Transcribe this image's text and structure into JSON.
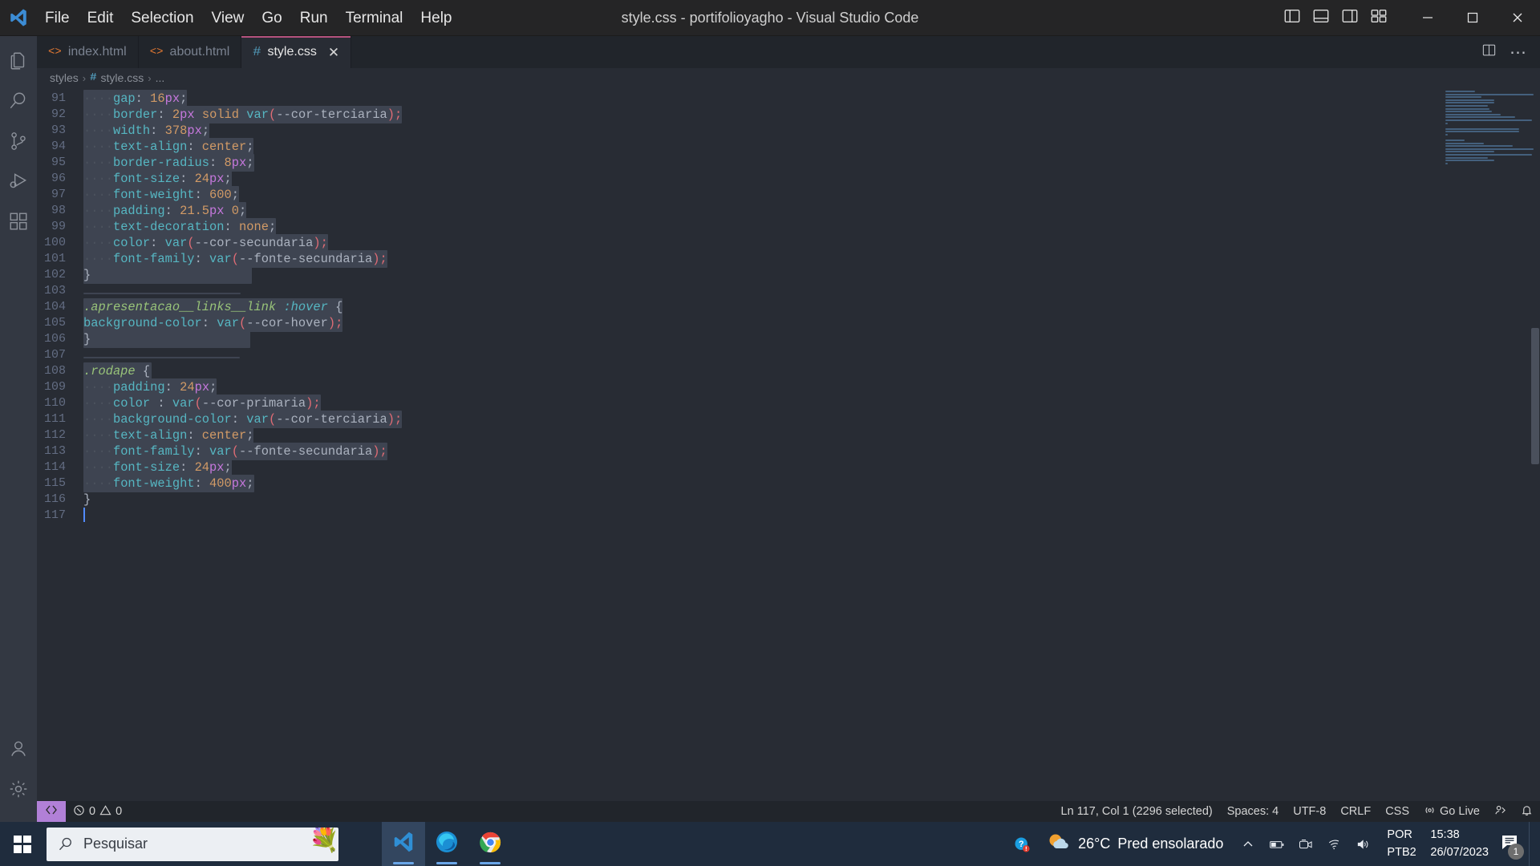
{
  "window": {
    "title": "style.css - portifolioyagho - Visual Studio Code",
    "app_logo": "vscode-logo"
  },
  "menubar": {
    "items": [
      {
        "label": "File"
      },
      {
        "label": "Edit"
      },
      {
        "label": "Selection"
      },
      {
        "label": "View"
      },
      {
        "label": "Go"
      },
      {
        "label": "Run"
      },
      {
        "label": "Terminal"
      },
      {
        "label": "Help"
      }
    ]
  },
  "titlebar_actions": {
    "icons": [
      "toggle-primary-sidebar-icon",
      "toggle-panel-icon",
      "toggle-secondary-sidebar-icon",
      "customize-layout-icon"
    ],
    "minimize": "minimize-icon",
    "maximize": "maximize-icon",
    "close": "close-icon"
  },
  "activitybar": {
    "top": [
      {
        "name": "explorer",
        "icon": "files-icon"
      },
      {
        "name": "search",
        "icon": "search-icon"
      },
      {
        "name": "source-control",
        "icon": "source-control-icon"
      },
      {
        "name": "run-and-debug",
        "icon": "debug-icon"
      },
      {
        "name": "extensions",
        "icon": "extensions-icon"
      }
    ],
    "bottom": [
      {
        "name": "accounts",
        "icon": "account-icon"
      },
      {
        "name": "settings",
        "icon": "gear-icon"
      }
    ]
  },
  "tabs": [
    {
      "label": "index.html",
      "icon": "html-file-icon",
      "icon_glyph": "<>",
      "active": false,
      "closable": false
    },
    {
      "label": "about.html",
      "icon": "html-file-icon",
      "icon_glyph": "<>",
      "active": false,
      "closable": false
    },
    {
      "label": "style.css",
      "icon": "css-file-icon",
      "icon_glyph": "#",
      "active": true,
      "closable": true,
      "close_glyph": "✕"
    }
  ],
  "tabsbar_actions": {
    "split_editor": "split-editor-icon",
    "more_actions": "⋯"
  },
  "breadcrumb": {
    "parts": [
      "styles",
      "style.css",
      "..."
    ],
    "separator": "›",
    "file_icon_glyph": "#"
  },
  "editor": {
    "language": "CSS",
    "first_line": 91,
    "lines": [
      {
        "no": 91,
        "indent": "    ",
        "tokens": [
          {
            "t": "gap",
            "c": "prop"
          },
          {
            "t": ": ",
            "c": "punc"
          },
          {
            "t": "16",
            "c": "num"
          },
          {
            "t": "px",
            "c": "unit"
          },
          {
            "t": ";",
            "c": "punc"
          }
        ],
        "sel_width": 92
      },
      {
        "no": 92,
        "indent": "    ",
        "tokens": [
          {
            "t": "border",
            "c": "prop"
          },
          {
            "t": ": ",
            "c": "punc"
          },
          {
            "t": "2",
            "c": "num"
          },
          {
            "t": "px",
            "c": "unit"
          },
          {
            "t": " ",
            "c": "punc"
          },
          {
            "t": "solid",
            "c": "kwsolid"
          },
          {
            "t": " ",
            "c": "punc"
          },
          {
            "t": "var",
            "c": "fn"
          },
          {
            "t": "(",
            "c": "paren"
          },
          {
            "t": "--cor-terciaria",
            "c": "varname"
          },
          {
            "t": ")",
            "c": "paren"
          },
          {
            "t": ";",
            "c": "paren"
          }
        ],
        "sel_width": 288
      },
      {
        "no": 93,
        "indent": "    ",
        "tokens": [
          {
            "t": "width",
            "c": "prop"
          },
          {
            "t": ": ",
            "c": "punc"
          },
          {
            "t": "378",
            "c": "num"
          },
          {
            "t": "px",
            "c": "unit"
          },
          {
            "t": ";",
            "c": "punc"
          }
        ],
        "sel_width": 115
      },
      {
        "no": 94,
        "indent": "    ",
        "tokens": [
          {
            "t": "text-align",
            "c": "prop"
          },
          {
            "t": ": ",
            "c": "punc"
          },
          {
            "t": "center",
            "c": "val"
          },
          {
            "t": ";",
            "c": "punc"
          }
        ],
        "sel_width": 152
      },
      {
        "no": 95,
        "indent": "    ",
        "tokens": [
          {
            "t": "border-radius",
            "c": "prop"
          },
          {
            "t": ": ",
            "c": "punc"
          },
          {
            "t": "8",
            "c": "num"
          },
          {
            "t": "px",
            "c": "unit"
          },
          {
            "t": ";",
            "c": "punc"
          }
        ],
        "sel_width": 155
      },
      {
        "no": 96,
        "indent": "    ",
        "tokens": [
          {
            "t": "font-size",
            "c": "prop"
          },
          {
            "t": ": ",
            "c": "punc"
          },
          {
            "t": "24",
            "c": "num"
          },
          {
            "t": "px",
            "c": "unit"
          },
          {
            "t": ";",
            "c": "punc"
          }
        ],
        "sel_width": 135
      },
      {
        "no": 97,
        "indent": "    ",
        "tokens": [
          {
            "t": "font-weight",
            "c": "prop"
          },
          {
            "t": ": ",
            "c": "punc"
          },
          {
            "t": "600",
            "c": "num"
          },
          {
            "t": ";",
            "c": "punc"
          }
        ],
        "sel_width": 140
      },
      {
        "no": 98,
        "indent": "    ",
        "tokens": [
          {
            "t": "padding",
            "c": "prop"
          },
          {
            "t": ": ",
            "c": "punc"
          },
          {
            "t": "21.5",
            "c": "num"
          },
          {
            "t": "px",
            "c": "unit"
          },
          {
            "t": " ",
            "c": "punc"
          },
          {
            "t": "0",
            "c": "num"
          },
          {
            "t": ";",
            "c": "punc"
          }
        ],
        "sel_width": 148
      },
      {
        "no": 99,
        "indent": "    ",
        "tokens": [
          {
            "t": "text-decoration",
            "c": "prop"
          },
          {
            "t": ": ",
            "c": "punc"
          },
          {
            "t": "none",
            "c": "val"
          },
          {
            "t": ";",
            "c": "punc"
          }
        ],
        "sel_width": 175
      },
      {
        "no": 100,
        "indent": "    ",
        "tokens": [
          {
            "t": "color",
            "c": "prop"
          },
          {
            "t": ": ",
            "c": "punc"
          },
          {
            "t": "var",
            "c": "fn"
          },
          {
            "t": "(",
            "c": "paren"
          },
          {
            "t": "--cor-secundaria",
            "c": "varname"
          },
          {
            "t": ")",
            "c": "paren"
          },
          {
            "t": ";",
            "c": "paren"
          }
        ],
        "sel_width": 220
      },
      {
        "no": 101,
        "indent": "    ",
        "tokens": [
          {
            "t": "font-family",
            "c": "prop"
          },
          {
            "t": ": ",
            "c": "punc"
          },
          {
            "t": "var",
            "c": "fn"
          },
          {
            "t": "(",
            "c": "paren"
          },
          {
            "t": "--fonte-secundaria",
            "c": "varname"
          },
          {
            "t": ")",
            "c": "paren"
          },
          {
            "t": ";",
            "c": "paren"
          }
        ],
        "sel_width": 272
      },
      {
        "no": 102,
        "indent": "",
        "tokens": [
          {
            "t": "}",
            "c": "brace"
          }
        ],
        "sel_width": 210
      },
      {
        "no": 103,
        "indent": "",
        "tokens": [],
        "sel_width": 196
      },
      {
        "no": 104,
        "indent": "",
        "tokens": [
          {
            "t": ".apresentacao__links__link",
            "c": "selector"
          },
          {
            "t": " ",
            "c": "punc"
          },
          {
            "t": ":hover",
            "c": "pseudo"
          },
          {
            "t": " ",
            "c": "punc"
          },
          {
            "t": "{",
            "c": "brace"
          }
        ],
        "sel_width": 235
      },
      {
        "no": 105,
        "indent": "",
        "tokens": [
          {
            "t": "background-color",
            "c": "prop"
          },
          {
            "t": ": ",
            "c": "punc"
          },
          {
            "t": "var",
            "c": "fn"
          },
          {
            "t": "(",
            "c": "paren"
          },
          {
            "t": "--cor-hover",
            "c": "varname"
          },
          {
            "t": ")",
            "c": "paren"
          },
          {
            "t": ";",
            "c": "paren"
          }
        ],
        "sel_width": 238
      },
      {
        "no": 106,
        "indent": "",
        "tokens": [
          {
            "t": "}",
            "c": "brace"
          }
        ],
        "sel_width": 208
      },
      {
        "no": 107,
        "indent": "",
        "tokens": [],
        "sel_width": 195
      },
      {
        "no": 108,
        "indent": "",
        "tokens": [
          {
            "t": ".rodape",
            "c": "selector"
          },
          {
            "t": " ",
            "c": "punc"
          },
          {
            "t": "{",
            "c": "brace"
          }
        ],
        "sel_width": 85
      },
      {
        "no": 109,
        "indent": "    ",
        "tokens": [
          {
            "t": "padding",
            "c": "prop"
          },
          {
            "t": ": ",
            "c": "punc"
          },
          {
            "t": "24",
            "c": "num"
          },
          {
            "t": "px",
            "c": "unit"
          },
          {
            "t": ";",
            "c": "punc"
          }
        ],
        "sel_width": 122
      },
      {
        "no": 110,
        "indent": "    ",
        "tokens": [
          {
            "t": "color ",
            "c": "prop"
          },
          {
            "t": ": ",
            "c": "punc"
          },
          {
            "t": "var",
            "c": "fn"
          },
          {
            "t": "(",
            "c": "paren"
          },
          {
            "t": "--cor-primaria",
            "c": "varname"
          },
          {
            "t": ")",
            "c": "paren"
          },
          {
            "t": ";",
            "c": "paren"
          }
        ],
        "sel_width": 215
      },
      {
        "no": 111,
        "indent": "    ",
        "tokens": [
          {
            "t": "background-color",
            "c": "prop"
          },
          {
            "t": ": ",
            "c": "punc"
          },
          {
            "t": "var",
            "c": "fn"
          },
          {
            "t": "(",
            "c": "paren"
          },
          {
            "t": "--cor-terciaria",
            "c": "varname"
          },
          {
            "t": ")",
            "c": "paren"
          },
          {
            "t": ";",
            "c": "paren"
          }
        ],
        "sel_width": 288
      },
      {
        "no": 112,
        "indent": "    ",
        "tokens": [
          {
            "t": "text-align",
            "c": "prop"
          },
          {
            "t": ": ",
            "c": "punc"
          },
          {
            "t": "center",
            "c": "val"
          },
          {
            "t": ";",
            "c": "punc"
          }
        ],
        "sel_width": 152
      },
      {
        "no": 113,
        "indent": "    ",
        "tokens": [
          {
            "t": "font-family",
            "c": "prop"
          },
          {
            "t": ": ",
            "c": "punc"
          },
          {
            "t": "var",
            "c": "fn"
          },
          {
            "t": "(",
            "c": "paren"
          },
          {
            "t": "--fonte-secundaria",
            "c": "varname"
          },
          {
            "t": ")",
            "c": "paren"
          },
          {
            "t": ";",
            "c": "paren"
          }
        ],
        "sel_width": 272
      },
      {
        "no": 114,
        "indent": "    ",
        "tokens": [
          {
            "t": "font-size",
            "c": "prop"
          },
          {
            "t": ": ",
            "c": "punc"
          },
          {
            "t": "24",
            "c": "num"
          },
          {
            "t": "px",
            "c": "unit"
          },
          {
            "t": ";",
            "c": "punc"
          }
        ],
        "sel_width": 135
      },
      {
        "no": 115,
        "indent": "    ",
        "tokens": [
          {
            "t": "font-weight",
            "c": "prop"
          },
          {
            "t": ": ",
            "c": "punc"
          },
          {
            "t": "400",
            "c": "num"
          },
          {
            "t": "px",
            "c": "unit"
          },
          {
            "t": ";",
            "c": "punc"
          }
        ],
        "sel_width": 158
      },
      {
        "no": 116,
        "indent": "",
        "tokens": [
          {
            "t": "}",
            "c": "brace"
          }
        ],
        "sel_width": 0
      },
      {
        "no": 117,
        "indent": "",
        "tokens": [],
        "sel_width": 0,
        "cursor": true
      }
    ]
  },
  "statusbar": {
    "remote_icon": "remote-window-icon",
    "problems": {
      "errors": "0",
      "warnings": "0",
      "error_icon": "error-icon",
      "warning_icon": "warning-icon"
    },
    "cursor_position": "Ln 117, Col 1 (2296 selected)",
    "indentation": "Spaces: 4",
    "encoding": "UTF-8",
    "eol": "CRLF",
    "language_mode": "CSS",
    "go_live": "Go Live",
    "go_live_icon": "broadcast-icon",
    "feedback_icon": "feedback-icon",
    "bell_icon": "bell-icon"
  },
  "taskbar": {
    "start_icon": "windows-start-icon",
    "search": {
      "placeholder": "Pesquisar",
      "icon": "search-icon",
      "decoration": "💐"
    },
    "apps": [
      {
        "name": "task-view",
        "icon": "task-view-icon"
      },
      {
        "name": "visual-studio-code",
        "icon": "vscode-icon",
        "running": true,
        "active": true
      },
      {
        "name": "microsoft-edge",
        "icon": "edge-icon",
        "running": true
      },
      {
        "name": "google-chrome",
        "icon": "chrome-icon",
        "running": true
      }
    ],
    "tray": {
      "help_icon": "help-icon",
      "weather": {
        "temperature": "26°C",
        "condition": "Pred ensolarado",
        "icon": "partly-sunny-icon"
      },
      "overflow_icon": "chevron-up-icon",
      "battery_icon": "battery-icon",
      "camera_icon": "camera-icon",
      "network_icon": "wifi-icon",
      "volume_icon": "volume-icon",
      "language": {
        "line1": "POR",
        "line2": "PTB2"
      },
      "clock": {
        "time": "15:38",
        "date": "26/07/2023"
      },
      "notifications": {
        "icon": "notification-icon",
        "count": "1"
      }
    }
  },
  "colors": {
    "accent": "#b5527e",
    "editor_bg": "#282c34",
    "selection": "#3e4451",
    "statusbar_bg": "#21252b",
    "remote_badge": "#b180d7",
    "taskbar_bg": "#1f2c3d"
  }
}
